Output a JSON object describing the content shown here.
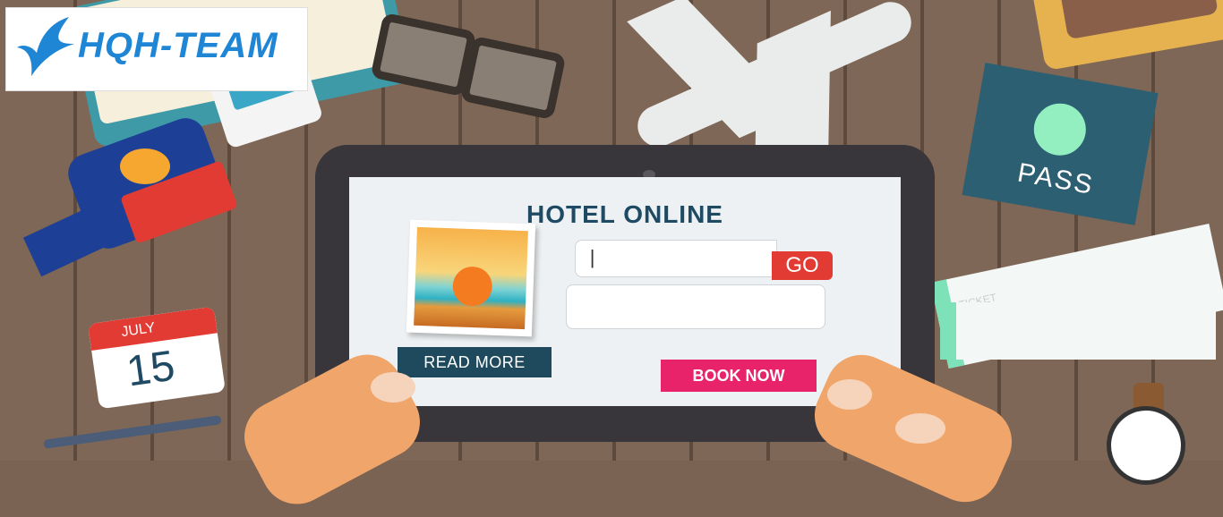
{
  "logo": {
    "text": "HQH-TEAM"
  },
  "tablet": {
    "title": "HOTEL ONLINE",
    "search": {
      "caret": "|",
      "go_label": "GO"
    },
    "read_more_label": "READ MORE",
    "book_now_label": "BOOK NOW"
  },
  "passport": {
    "label": "PASS"
  },
  "ticket": {
    "label": "TICKET"
  },
  "calendar": {
    "month": "JULY",
    "day": "15"
  },
  "colors": {
    "brand_blue": "#1f86d6",
    "title_navy": "#1e4a63",
    "go_red": "#e23b34",
    "book_pink": "#e8236a",
    "read_more_teal": "#1f4a5d"
  }
}
